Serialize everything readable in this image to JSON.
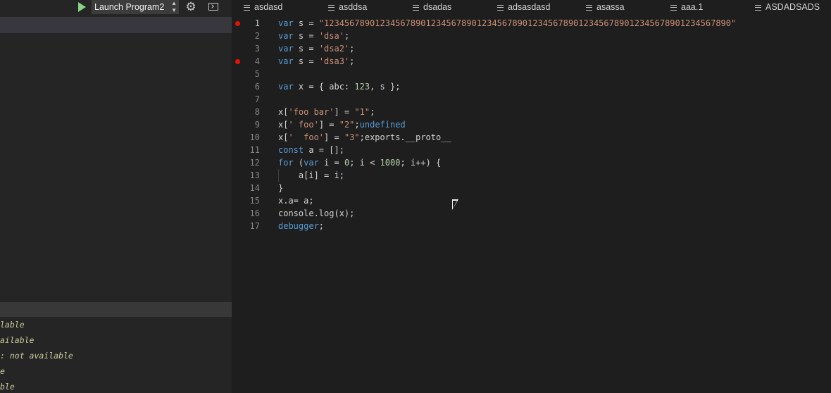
{
  "debug_toolbar": {
    "configuration": "Launch Program2"
  },
  "icons": {
    "run": "play-icon",
    "config_select": "select-arrows-icon",
    "settings": "gear-icon",
    "console": "terminal-icon",
    "tab": "file-lines-icon",
    "breakpoint": "breakpoint-dot"
  },
  "colors": {
    "run_green": "#89d185",
    "breakpoint_red": "#e51400",
    "keyword": "#569cd6",
    "string": "#ce9178",
    "number": "#b5cea8"
  },
  "tabs": [
    {
      "label": "asdasd"
    },
    {
      "label": "asddsa"
    },
    {
      "label": "dsadas"
    },
    {
      "label": "adsasdasd"
    },
    {
      "label": "asassa"
    },
    {
      "label": "aaa.1"
    },
    {
      "label": "ASDADSADS"
    }
  ],
  "watch": {
    "items": [
      {
        "text": "lable"
      },
      {
        "text": "ailable"
      },
      {
        "text": ": not available"
      },
      {
        "text": "e"
      },
      {
        "text": "ble"
      }
    ]
  },
  "editor": {
    "active_line": 1,
    "breakpoints": [
      1,
      4
    ],
    "lines": [
      {
        "n": "1",
        "tokens": [
          {
            "t": "var",
            "k": "kw"
          },
          {
            "t": " s = "
          },
          {
            "t": "\"12345678901234567890123456789012345678901234567890123456789012345678901234567890\"",
            "k": "str"
          }
        ]
      },
      {
        "n": "2",
        "tokens": [
          {
            "t": "var",
            "k": "kw"
          },
          {
            "t": " s = "
          },
          {
            "t": "'dsa'",
            "k": "str"
          },
          {
            "t": ";"
          }
        ]
      },
      {
        "n": "3",
        "tokens": [
          {
            "t": "var",
            "k": "kw"
          },
          {
            "t": " s = "
          },
          {
            "t": "'dsa2'",
            "k": "str"
          },
          {
            "t": ";"
          }
        ]
      },
      {
        "n": "4",
        "tokens": [
          {
            "t": "var",
            "k": "kw"
          },
          {
            "t": " s = "
          },
          {
            "t": "'dsa3'",
            "k": "str"
          },
          {
            "t": ";"
          }
        ]
      },
      {
        "n": "5",
        "tokens": []
      },
      {
        "n": "6",
        "tokens": [
          {
            "t": "var",
            "k": "kw"
          },
          {
            "t": " x = { abc: "
          },
          {
            "t": "123",
            "k": "num"
          },
          {
            "t": ", s };"
          }
        ]
      },
      {
        "n": "7",
        "tokens": []
      },
      {
        "n": "8",
        "tokens": [
          {
            "t": "x["
          },
          {
            "t": "'foo bar'",
            "k": "str"
          },
          {
            "t": "] = "
          },
          {
            "t": "\"1\"",
            "k": "str"
          },
          {
            "t": ";"
          }
        ]
      },
      {
        "n": "9",
        "tokens": [
          {
            "t": "x["
          },
          {
            "t": "' foo'",
            "k": "str"
          },
          {
            "t": "] = "
          },
          {
            "t": "\"2\"",
            "k": "str"
          },
          {
            "t": ";"
          },
          {
            "t": "undefined",
            "k": "kw"
          }
        ]
      },
      {
        "n": "10",
        "tokens": [
          {
            "t": "x["
          },
          {
            "t": "'  foo'",
            "k": "str"
          },
          {
            "t": "] = "
          },
          {
            "t": "\"3\"",
            "k": "str"
          },
          {
            "t": ";exports.__proto__"
          }
        ]
      },
      {
        "n": "11",
        "tokens": [
          {
            "t": "const",
            "k": "kw"
          },
          {
            "t": " a = [];"
          }
        ]
      },
      {
        "n": "12",
        "tokens": [
          {
            "t": "for",
            "k": "kw"
          },
          {
            "t": " ("
          },
          {
            "t": "var",
            "k": "kw"
          },
          {
            "t": " i = "
          },
          {
            "t": "0",
            "k": "num"
          },
          {
            "t": "; i < "
          },
          {
            "t": "1000",
            "k": "num"
          },
          {
            "t": "; i++) {"
          }
        ]
      },
      {
        "n": "13",
        "indent": true,
        "tokens": [
          {
            "t": "    a[i] = i;"
          }
        ]
      },
      {
        "n": "14",
        "tokens": [
          {
            "t": "}"
          }
        ]
      },
      {
        "n": "15",
        "tokens": [
          {
            "t": "x.a= a;"
          }
        ]
      },
      {
        "n": "16",
        "tokens": [
          {
            "t": "console.log(x);"
          }
        ]
      },
      {
        "n": "17",
        "tokens": [
          {
            "t": "debugger",
            "k": "kw"
          },
          {
            "t": ";"
          }
        ]
      }
    ]
  }
}
